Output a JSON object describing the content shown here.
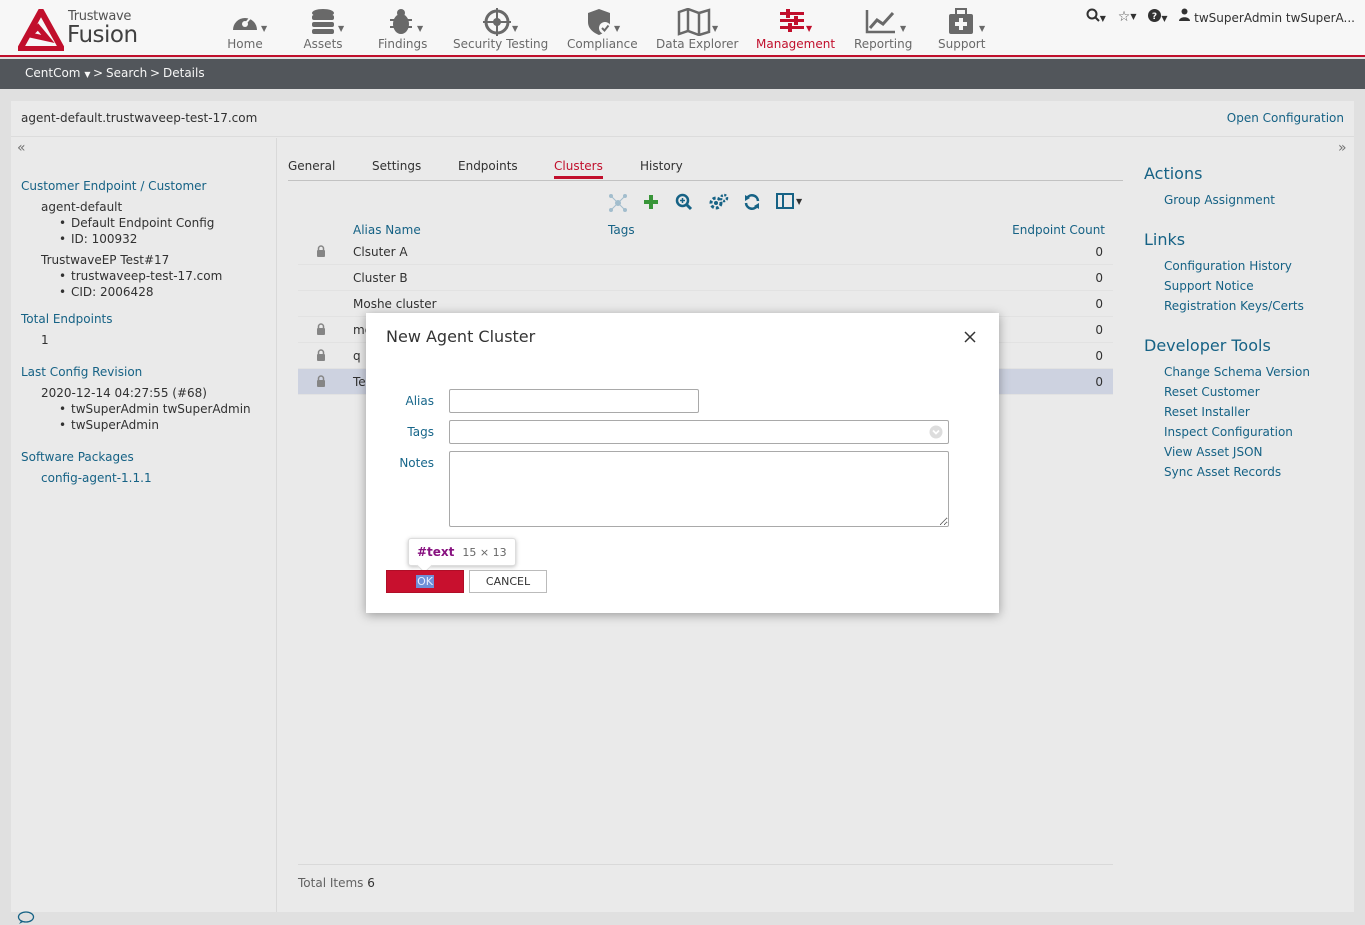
{
  "logo": {
    "top": "Trustwave",
    "bottom": "Fusion"
  },
  "nav": [
    {
      "label": "Home",
      "icon": "dashboard-icon"
    },
    {
      "label": "Assets",
      "icon": "database-icon"
    },
    {
      "label": "Findings",
      "icon": "bug-icon"
    },
    {
      "label": "Security Testing",
      "icon": "crosshair-icon"
    },
    {
      "label": "Compliance",
      "icon": "shield-check-icon"
    },
    {
      "label": "Data Explorer",
      "icon": "map-icon"
    },
    {
      "label": "Management",
      "icon": "sliders-icon",
      "active": true
    },
    {
      "label": "Reporting",
      "icon": "line-chart-icon"
    },
    {
      "label": "Support",
      "icon": "medkit-icon"
    }
  ],
  "user": {
    "name": "twSuperAdmin twSuperA..."
  },
  "breadcrumb": {
    "root": "CentCom",
    "sep1": ">",
    "search": "Search",
    "sep2": ">",
    "current": "Details"
  },
  "header": {
    "host": "agent-default.trustwaveep-test-17.com",
    "open_config": "Open Configuration"
  },
  "left": {
    "customer_heading": "Customer Endpoint / Customer",
    "endpoint_name": "agent-default",
    "endpoint_config": "Default Endpoint Config",
    "endpoint_id": "ID: 100932",
    "customer_name": "TrustwaveEP Test#17",
    "customer_domain": "trustwaveep-test-17.com",
    "customer_cid": "CID: 2006428",
    "total_heading": "Total Endpoints",
    "total_value": "1",
    "revision_heading": "Last Config Revision",
    "revision_date": "2020-12-14 04:27:55 (#68)",
    "revision_user1": "twSuperAdmin twSuperAdmin",
    "revision_user2": "twSuperAdmin",
    "packages_heading": "Software Packages",
    "package1": "config-agent-1.1.1"
  },
  "tabs": [
    "General",
    "Settings",
    "Endpoints",
    "Clusters",
    "History"
  ],
  "active_tab": "Clusters",
  "grid": {
    "columns": [
      "Alias Name",
      "Tags",
      "Endpoint Count"
    ],
    "rows": [
      {
        "name": "Clsuter A",
        "count": "0",
        "locked": true
      },
      {
        "name": "Cluster B",
        "count": "0",
        "locked": false
      },
      {
        "name": "Moshe cluster",
        "count": "0",
        "locked": false
      },
      {
        "name": "mo",
        "count": "0",
        "locked": true
      },
      {
        "name": "q",
        "count": "0",
        "locked": true
      },
      {
        "name": "Te",
        "count": "0",
        "locked": true,
        "selected": true
      }
    ],
    "total_label": "Total Items",
    "total_value": "6"
  },
  "right": {
    "actions_heading": "Actions",
    "actions": [
      "Group Assignment"
    ],
    "links_heading": "Links",
    "links": [
      "Configuration History",
      "Support Notice",
      "Registration Keys/Certs"
    ],
    "dev_heading": "Developer Tools",
    "dev": [
      "Change Schema Version",
      "Reset Customer",
      "Reset Installer",
      "Inspect Configuration",
      "View Asset JSON",
      "Sync Asset Records"
    ]
  },
  "modal": {
    "title": "New Agent Cluster",
    "alias_label": "Alias",
    "alias_value": "",
    "tags_label": "Tags",
    "tags_value": "",
    "notes_label": "Notes",
    "notes_value": "",
    "ok_label": "OK",
    "cancel_label": "CANCEL"
  },
  "tooltip": {
    "tag": "#text",
    "dims": "15 × 13"
  },
  "colors": {
    "brand_red": "#c8102e",
    "link_blue": "#17668a",
    "crumb_bg": "#55595e"
  }
}
